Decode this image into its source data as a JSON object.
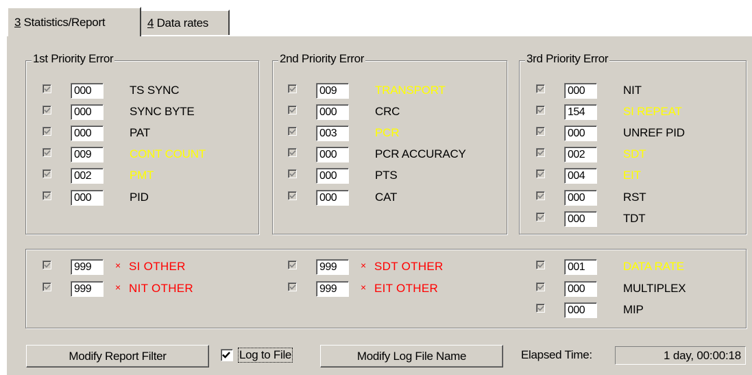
{
  "tabs": [
    {
      "accel": "3",
      "label": " Statistics/Report",
      "active": true
    },
    {
      "accel": "4",
      "label": " Data rates",
      "active": false
    }
  ],
  "groups": [
    {
      "title": "1st Priority Error",
      "rows": [
        {
          "value": "000",
          "label": "TS SYNC",
          "status": "normal"
        },
        {
          "value": "000",
          "label": "SYNC BYTE",
          "status": "normal"
        },
        {
          "value": "000",
          "label": "PAT",
          "status": "normal"
        },
        {
          "value": "009",
          "label": "CONT COUNT",
          "status": "warning"
        },
        {
          "value": "002",
          "label": "PMT",
          "status": "warning"
        },
        {
          "value": "000",
          "label": "PID",
          "status": "normal"
        }
      ]
    },
    {
      "title": "2nd Priority Error",
      "rows": [
        {
          "value": "009",
          "label": "TRANSPORT",
          "status": "warning"
        },
        {
          "value": "000",
          "label": "CRC",
          "status": "normal"
        },
        {
          "value": "003",
          "label": "PCR",
          "status": "warning"
        },
        {
          "value": "000",
          "label": "PCR ACCURACY",
          "status": "normal"
        },
        {
          "value": "000",
          "label": "PTS",
          "status": "normal"
        },
        {
          "value": "000",
          "label": "CAT",
          "status": "normal"
        }
      ]
    },
    {
      "title": "3rd Priority Error",
      "rows": [
        {
          "value": "000",
          "label": "NIT",
          "status": "normal"
        },
        {
          "value": "154",
          "label": "SI REPEAT",
          "status": "warning"
        },
        {
          "value": "000",
          "label": "UNREF PID",
          "status": "normal"
        },
        {
          "value": "002",
          "label": "SDT",
          "status": "warning"
        },
        {
          "value": "004",
          "label": "EIT",
          "status": "warning"
        },
        {
          "value": "000",
          "label": "RST",
          "status": "normal"
        },
        {
          "value": "000",
          "label": "TDT",
          "status": "normal"
        }
      ]
    }
  ],
  "other_group": {
    "columns": [
      [
        {
          "value": "999",
          "label": "SI OTHER",
          "status": "error",
          "mark": "×"
        },
        {
          "value": "999",
          "label": "NIT OTHER",
          "status": "error",
          "mark": "×"
        }
      ],
      [
        {
          "value": "999",
          "label": "SDT OTHER",
          "status": "error",
          "mark": "×"
        },
        {
          "value": "999",
          "label": "EIT OTHER",
          "status": "error",
          "mark": "×"
        }
      ],
      [
        {
          "value": "001",
          "label": "DATA RATE",
          "status": "warning"
        },
        {
          "value": "000",
          "label": "MULTIPLEX",
          "status": "normal"
        },
        {
          "value": "000",
          "label": "MIP",
          "status": "normal"
        }
      ]
    ]
  },
  "footer": {
    "modify_filter_label": "Modify Report Filter",
    "log_to_file_label": "Log to File",
    "log_to_file_checked": true,
    "modify_log_name_label": "Modify Log File Name",
    "elapsed_label": "Elapsed Time:",
    "elapsed_value": "1 day, 00:00:18"
  },
  "colors": {
    "panel": "#d4d0c8",
    "warning": "#ffff00",
    "error": "#ff0000"
  }
}
